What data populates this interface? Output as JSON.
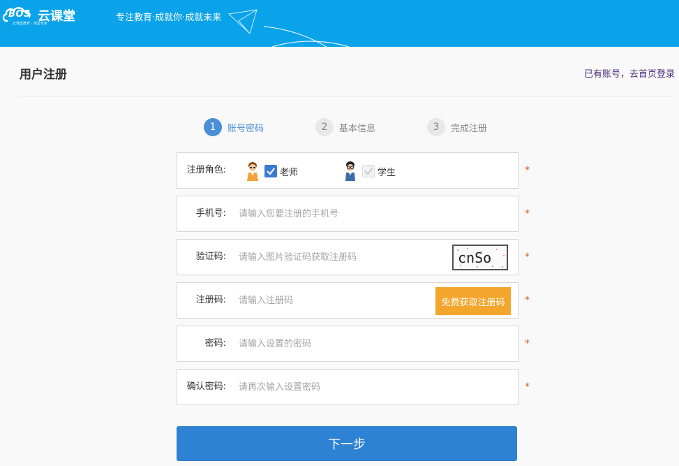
{
  "header": {
    "logo_bos": "BOS",
    "logo_text": "云课堂",
    "logo_sub": "云课堂教育 · 课堂专家",
    "slogan": "专注教育·成就你·成就未来"
  },
  "page": {
    "title": "用户注册",
    "login_link": "已有账号，去首页登录"
  },
  "steps": [
    {
      "num": "1",
      "label": "账号密码",
      "active": true
    },
    {
      "num": "2",
      "label": "基本信息",
      "active": false
    },
    {
      "num": "3",
      "label": "完成注册",
      "active": false
    }
  ],
  "form": {
    "role": {
      "label": "注册角色:",
      "teacher": "老师",
      "student": "学生",
      "teacher_checked": true,
      "student_checked": false
    },
    "phone": {
      "label": "手机号:",
      "placeholder": "请输入您要注册的手机号"
    },
    "captcha": {
      "label": "验证码:",
      "placeholder": "请输入图片验证码获取注册码",
      "image_text": "cnSo"
    },
    "reg_code": {
      "label": "注册码:",
      "placeholder": "请输入注册码",
      "button": "免费获取注册码"
    },
    "password": {
      "label": "密码:",
      "placeholder": "请输入设置的密码"
    },
    "confirm": {
      "label": "确认密码:",
      "placeholder": "请再次输入设置密码"
    },
    "required_mark": "*"
  },
  "next_button": "下一步",
  "colors": {
    "header_bg": "#0aa3e9",
    "primary": "#2e82d3",
    "step_active": "#4b8fd6",
    "code_button": "#f4a52c",
    "required": "#e05a2b"
  }
}
